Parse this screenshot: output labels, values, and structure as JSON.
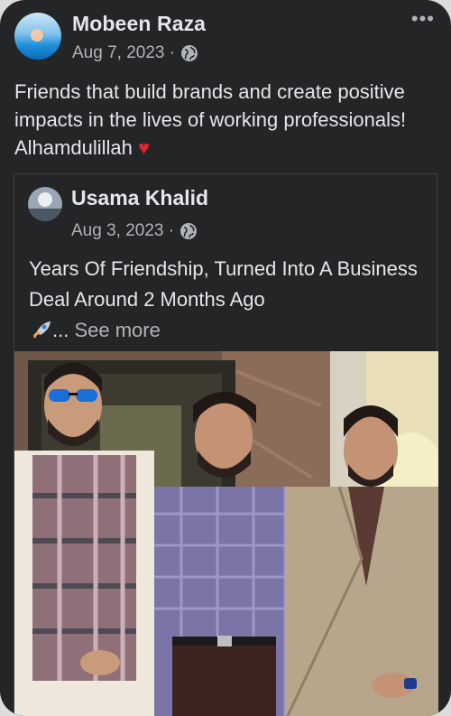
{
  "post": {
    "author": "Mobeen Raza",
    "date": "Aug 7, 2023 ·",
    "more_label": "•••",
    "text": "Friends that build brands and create positive impacts in the lives of working professionals! Alhamdulillah",
    "heart": "♥"
  },
  "shared": {
    "author": "Usama Khalid",
    "date": "Aug 3, 2023 ·",
    "text": "Years Of Friendship, Turned Into A Business Deal Around 2 Months Ago",
    "ellipsis": "... ",
    "see_more": "See more"
  },
  "colors": {
    "card_bg": "#242526",
    "text_primary": "#e4e6eb",
    "text_secondary": "#b0b3b8",
    "heart": "#e0242e"
  },
  "icons": [
    "globe-icon",
    "more-options-icon",
    "heart-icon",
    "rocket-icon"
  ]
}
